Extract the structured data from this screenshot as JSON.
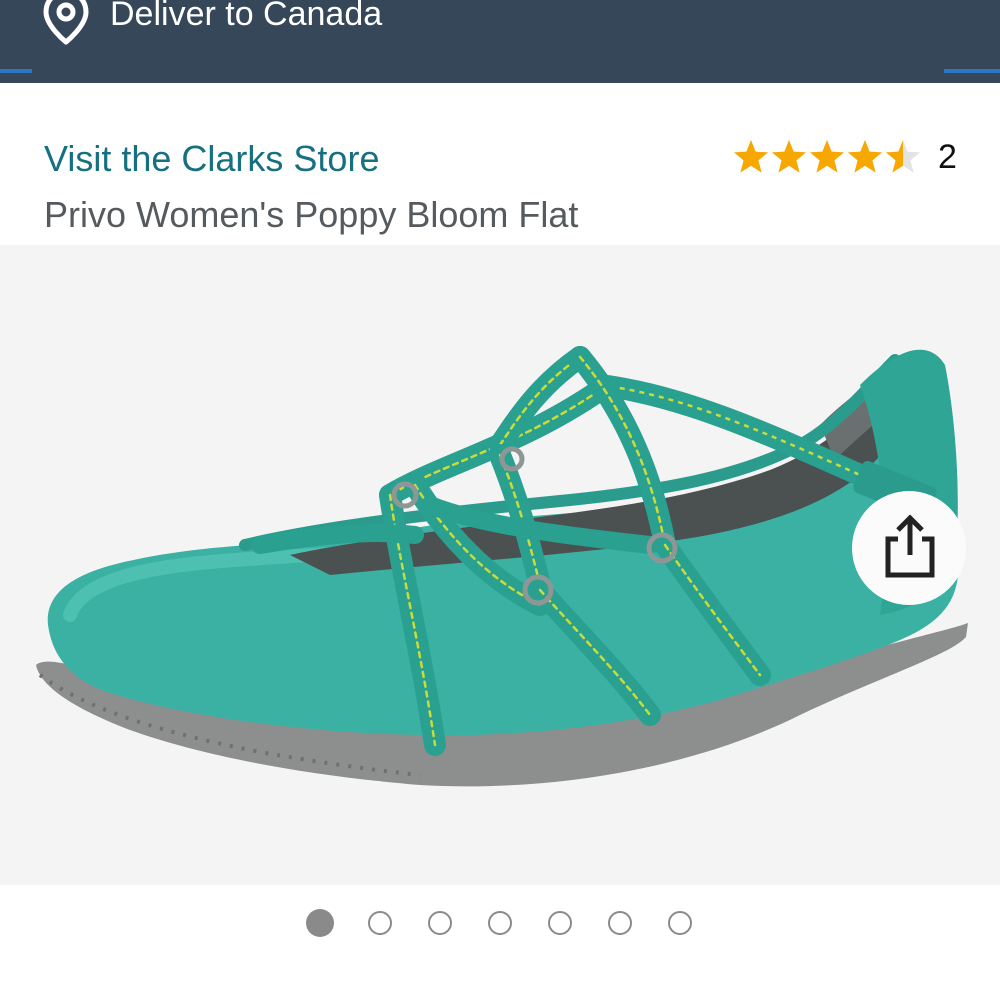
{
  "header": {
    "deliver_label": "Deliver to Canada",
    "location_icon": "location-pin-icon",
    "bar_color": "#37475a"
  },
  "product": {
    "store_link": "Visit the Clarks Store",
    "title": "Privo Women's Poppy Bloom Flat",
    "rating": {
      "stars": 4.5,
      "max": 5,
      "review_count": "2",
      "star_color": "#f7a800"
    }
  },
  "gallery": {
    "image_subject": "shoe-image",
    "share_icon": "share-icon",
    "total_images": 7,
    "active_index": 0
  }
}
